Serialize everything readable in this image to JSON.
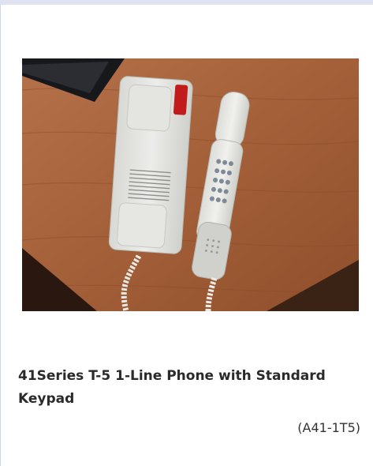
{
  "product": {
    "title": "41Series T-5 1-Line Phone with Standard Keypad",
    "sku": "(A41-1T5)",
    "image_alt": "41Series T-5 1-Line Phone with Standard Keypad"
  },
  "colors": {
    "page_background": "#ffffff",
    "top_bar": "#dfe3f1",
    "border": "#cfd6e4",
    "title_text": "#2a2a2a"
  }
}
